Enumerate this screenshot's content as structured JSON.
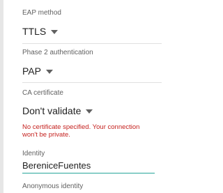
{
  "eap": {
    "label": "EAP method",
    "value": "TTLS"
  },
  "phase2": {
    "label": "Phase 2 authentication",
    "value": "PAP"
  },
  "ca": {
    "label": "CA certificate",
    "value": "Don't validate",
    "warning": "No certificate specified. Your connection won't be private."
  },
  "identity": {
    "label": "Identity",
    "value": "BereniceFuentes"
  },
  "anonymous": {
    "label": "Anonymous identity"
  },
  "colors": {
    "warning": "#c5221f",
    "accent": "#26a69a",
    "caret": "#616161"
  }
}
